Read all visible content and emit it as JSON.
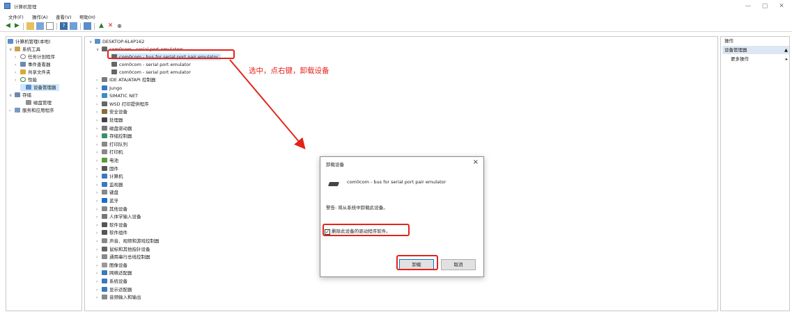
{
  "window": {
    "title": "计算机管理",
    "controls": [
      "—",
      "▢",
      "✕"
    ]
  },
  "menu": [
    "文件(F)",
    "操作(A)",
    "查看(V)",
    "帮助(H)"
  ],
  "left_tree": [
    {
      "label": "计算机管理(本地)"
    },
    {
      "label": "系统工具"
    },
    {
      "label": "任务计划程序"
    },
    {
      "label": "事件查看器"
    },
    {
      "label": "共享文件夹"
    },
    {
      "label": "性能"
    },
    {
      "label": "设备管理器"
    },
    {
      "label": "存储"
    },
    {
      "label": "磁盘管理"
    },
    {
      "label": "服务和应用程序"
    }
  ],
  "device_tree": {
    "root": "DESKTOP-6L4P162",
    "com0com_group": "com0com - serial port emulators",
    "com0com_children": [
      "com0com - bus for serial port pair emulator",
      "com0com - serial port emulator",
      "com0com - serial port emulator"
    ],
    "categories": [
      "IDE ATA/ATAPI 控制器",
      "Jungo",
      "SIMATIC NET",
      "WSD 打印提供程序",
      "安全设备",
      "处理器",
      "磁盘驱动器",
      "存储控制器",
      "打印队列",
      "打印机",
      "电池",
      "固件",
      "计算机",
      "监视器",
      "键盘",
      "蓝牙",
      "其他设备",
      "人体学输入设备",
      "软件设备",
      "软件组件",
      "声音、视频和游戏控制器",
      "鼠标和其他指针设备",
      "通用串行总线控制器",
      "图像设备",
      "网络适配器",
      "系统设备",
      "显示适配器",
      "音频输入和输出"
    ]
  },
  "annotation": {
    "text": "选中，点右键，卸载设备"
  },
  "dialog": {
    "title": "卸载设备",
    "device_name": "com0com - bus for serial port pair emulator",
    "warning": "警告: 将从系统中卸载此设备。",
    "checkbox_label": "删除此设备的驱动程序软件。",
    "checkbox_checked": true,
    "uninstall_label": "卸载",
    "cancel_label": "取消"
  },
  "action_pane": {
    "header": "操作",
    "section": "设备管理器",
    "more": "更多操作"
  },
  "colors": {
    "annotation_red": "#e2231a",
    "selection_blue": "#cce8ff"
  }
}
